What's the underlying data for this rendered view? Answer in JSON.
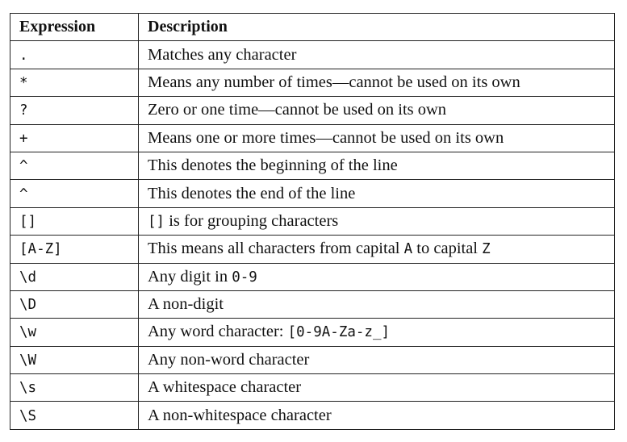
{
  "table": {
    "headers": {
      "expression": "Expression",
      "description": "Description"
    },
    "rows": [
      {
        "expression": ".",
        "description": [
          {
            "t": "Matches any character"
          }
        ]
      },
      {
        "expression": "*",
        "description": [
          {
            "t": "Means any number of times—cannot be used on its own"
          }
        ]
      },
      {
        "expression": "?",
        "description": [
          {
            "t": "Zero or one time—cannot be used on its own"
          }
        ]
      },
      {
        "expression": "+",
        "description": [
          {
            "t": "Means one or more times—cannot be used on its own"
          }
        ]
      },
      {
        "expression": "^",
        "description": [
          {
            "t": "This denotes the beginning of the line"
          }
        ]
      },
      {
        "expression": "^",
        "description": [
          {
            "t": "This denotes the end of the line"
          }
        ]
      },
      {
        "expression": "[]",
        "description": [
          {
            "t": "[]",
            "code": true
          },
          {
            "t": " is for grouping characters"
          }
        ]
      },
      {
        "expression": "[A-Z]",
        "description": [
          {
            "t": "This means all characters from capital "
          },
          {
            "t": "A",
            "code": true
          },
          {
            "t": " to capital "
          },
          {
            "t": "Z",
            "code": true
          }
        ]
      },
      {
        "expression": "\\d",
        "description": [
          {
            "t": "Any digit in "
          },
          {
            "t": "0-9",
            "code": true
          }
        ]
      },
      {
        "expression": "\\D",
        "description": [
          {
            "t": "A non-digit"
          }
        ]
      },
      {
        "expression": "\\w",
        "description": [
          {
            "t": "Any word character: "
          },
          {
            "t": "[0-9A-Za-z_]",
            "code": true
          }
        ]
      },
      {
        "expression": "\\W",
        "description": [
          {
            "t": "Any non-word character"
          }
        ]
      },
      {
        "expression": "\\s",
        "description": [
          {
            "t": "A whitespace character"
          }
        ]
      },
      {
        "expression": "\\S",
        "description": [
          {
            "t": "A non-whitespace character"
          }
        ]
      }
    ]
  }
}
